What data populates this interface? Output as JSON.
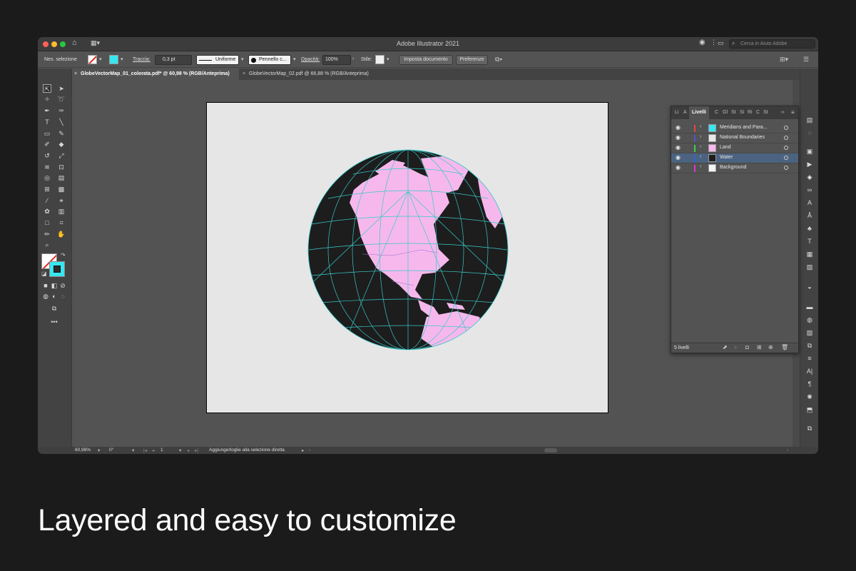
{
  "window": {
    "title": "Adobe Illustrator 2021"
  },
  "search": {
    "placeholder": "Cerca in Aiuto Adobe"
  },
  "control_bar": {
    "selection_label": "Nes. selezione",
    "stroke_label": "Traccia:",
    "stroke_weight": "0,3 pt",
    "stroke_profile": "Uniforme",
    "brush": "Pennello c...",
    "opacity_label": "Opacità:",
    "opacity_value": "100%",
    "style_label": "Stile:",
    "doc_setup_button": "Imposta documento",
    "preferences_button": "Preferenze"
  },
  "tabs": [
    {
      "label": "GlobeVectorMap_01_colorata.pdf* @ 60,98 % (RGB/Anteprima)",
      "active": true
    },
    {
      "label": "GlobeVectorMap_02.pdf @ 66,88 % (RGB/Anteprima)",
      "active": false
    }
  ],
  "layers_panel": {
    "tabs": [
      "Li",
      "A",
      "Livelli",
      "C",
      "Gl",
      "St",
      "Si",
      "Ri",
      "C",
      "St"
    ],
    "active_tab": "Livelli",
    "layers": [
      {
        "name": "Meridians and Para...",
        "color": "#e0483e",
        "selected": false
      },
      {
        "name": "National Boundaries",
        "color": "#4a56d8",
        "selected": false
      },
      {
        "name": "Land",
        "color": "#3ed04a",
        "selected": false
      },
      {
        "name": "Water",
        "color": "#3a62d6",
        "selected": true
      },
      {
        "name": "Background",
        "color": "#d63ad0",
        "selected": false
      }
    ],
    "footer_count": "5 livelli"
  },
  "status_bar": {
    "zoom": "60,98%",
    "rotation": "0°",
    "artboard": "1",
    "hint": "Aggiunge/toglie alla selezione diretta"
  },
  "globe": {
    "land_color": "#f6b8ec",
    "water_color": "#1d1d1d",
    "graticule_color": "#38c8c8"
  },
  "caption": "Layered and easy to customize"
}
